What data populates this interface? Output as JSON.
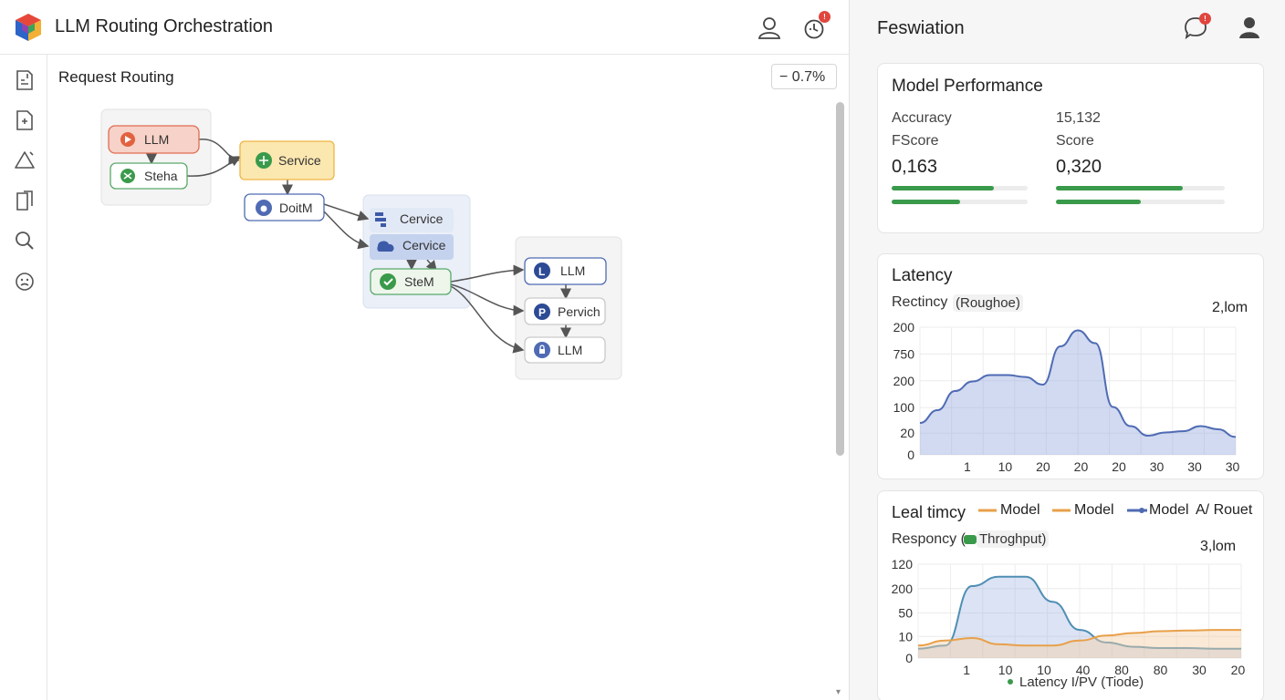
{
  "app": {
    "title": "LLM Routing Orchestration"
  },
  "colors": {
    "accent_green": "#3a9a4b",
    "badge_red": "#e0463e",
    "area_blue": "#9aaee0",
    "line_blue": "#4f6bb3",
    "line_orange": "#e8a04a"
  },
  "topbar": {
    "notification_badge": "!"
  },
  "sidebar": {
    "items": [
      {
        "icon": "document-chart-icon"
      },
      {
        "icon": "file-plus-icon"
      },
      {
        "icon": "triangle-alert-icon"
      },
      {
        "icon": "file-export-icon"
      },
      {
        "icon": "search-icon"
      },
      {
        "icon": "emoji-icon"
      }
    ]
  },
  "canvas": {
    "title": "Request Routing",
    "zoom": "− 0.7%",
    "nodes": {
      "n1": {
        "label": "LLM",
        "icon": "play-icon"
      },
      "n2": {
        "label": "Steha",
        "icon": "network-icon"
      },
      "n3": {
        "label": "Service",
        "icon": "gear-icon"
      },
      "n4": {
        "label": "DoitM",
        "icon": "drop-icon"
      },
      "n5": {
        "label": "Cervice",
        "icon": "server-icon"
      },
      "n6": {
        "label": "Cervice",
        "icon": "cloud-icon"
      },
      "n7": {
        "label": "SteM",
        "icon": "check-icon"
      },
      "n8": {
        "label": "LLM",
        "icon": "letter-l-icon"
      },
      "n9": {
        "label": "Pervich",
        "icon": "letter-p-icon"
      },
      "n10": {
        "label": "LLM",
        "icon": "lock-icon"
      }
    }
  },
  "panel": {
    "title": "Feswiation",
    "notification_badge": "!",
    "performance": {
      "title": "Model Performance",
      "left": {
        "label1": "Accuracy",
        "label2": "FScore",
        "value": "0,163",
        "bar1": 0.75,
        "bar2": 0.5
      },
      "right": {
        "label1": "15,132",
        "label2": "Score",
        "value": "0,320",
        "bar1": 0.75,
        "bar2": 0.5
      }
    },
    "latency": {
      "title": "Latency",
      "subtitle": "Rectincy",
      "chip": "(Roughoe)",
      "stat": "2,lom"
    },
    "throughput": {
      "title": "Leal timcy",
      "legend": [
        "Model",
        "Model",
        "Model",
        "A/ Rouet"
      ],
      "subtitle": "Responcy (",
      "chip": "Throghput)",
      "stat": "3,lom",
      "footer": "Latency I/PV (Tiode)"
    }
  },
  "chart_data": [
    {
      "type": "area",
      "title": "Latency",
      "y_tick_labels": [
        "200",
        "750",
        "200",
        "100",
        "20",
        "0"
      ],
      "x_tick_labels": [
        "1",
        "10",
        "20",
        "20",
        "20",
        "30",
        "30",
        "30"
      ],
      "series": [
        {
          "values": [
            50,
            70,
            100,
            115,
            125,
            125,
            122,
            110,
            170,
            195,
            175,
            75,
            45,
            30,
            35,
            37,
            45,
            40,
            28
          ]
        }
      ]
    },
    {
      "type": "area",
      "title": "Leal timcy",
      "y_tick_labels": [
        "120",
        "200",
        "50",
        "10",
        "0"
      ],
      "x_tick_labels": [
        "1",
        "10",
        "10",
        "40",
        "80",
        "80",
        "30",
        "20"
      ],
      "series": [
        {
          "values": [
            15,
            20,
            115,
            130,
            130,
            90,
            45,
            25,
            18,
            16,
            16,
            15,
            15
          ]
        },
        {
          "values": [
            20,
            28,
            32,
            22,
            20,
            20,
            28,
            36,
            40,
            43,
            44,
            45,
            45
          ]
        }
      ]
    }
  ]
}
